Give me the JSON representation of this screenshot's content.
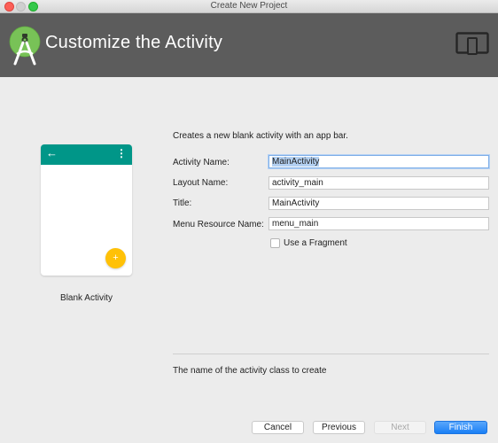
{
  "window": {
    "title": "Create New Project"
  },
  "header": {
    "title": "Customize the Activity",
    "logo_icon": "android-studio-logo",
    "device_icon": "phone-tablet-icon"
  },
  "preview": {
    "label": "Blank Activity",
    "appbar_color": "#009688",
    "fab_color": "#ffc107",
    "fab_symbol": "+",
    "back_symbol": "←",
    "overflow_symbol": "⋮"
  },
  "form": {
    "description": "Creates a new blank activity with an app bar.",
    "fields": [
      {
        "label": "Activity Name:",
        "value": "MainActivity"
      },
      {
        "label": "Layout Name:",
        "value": "activity_main"
      },
      {
        "label": "Title:",
        "value": "MainActivity"
      },
      {
        "label": "Menu Resource Name:",
        "value": "menu_main"
      }
    ],
    "fragment_checkbox": {
      "label": "Use a Fragment",
      "checked": false
    },
    "help_text": "The name of the activity class to create"
  },
  "buttons": {
    "cancel": "Cancel",
    "previous": "Previous",
    "next": "Next",
    "finish": "Finish"
  }
}
